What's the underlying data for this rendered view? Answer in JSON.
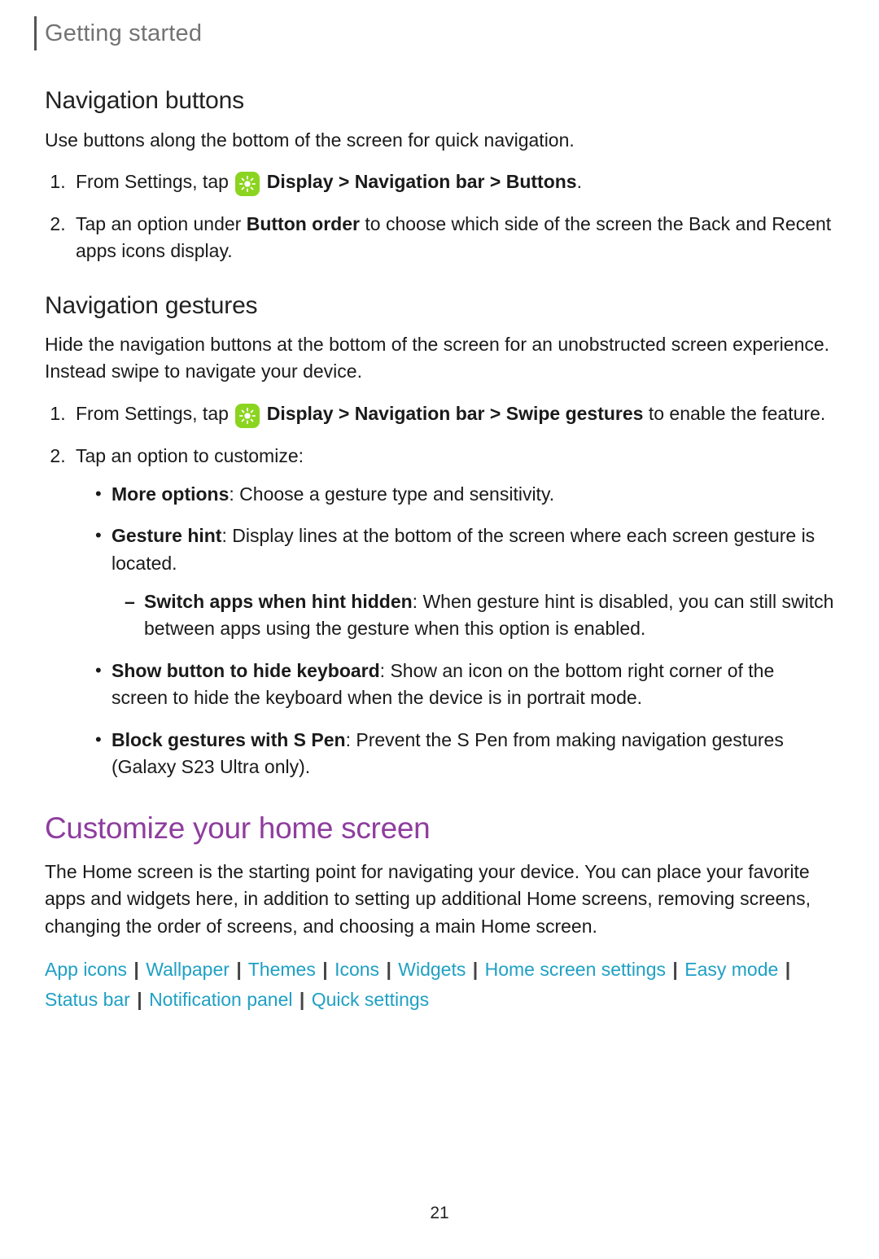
{
  "header": {
    "section": "Getting started"
  },
  "navButtons": {
    "title": "Navigation buttons",
    "intro": "Use buttons along the bottom of the screen for quick navigation.",
    "step1": {
      "lead": "From Settings, tap ",
      "pathA": "Display",
      "sepA": " > ",
      "pathB": "Navigation bar",
      "sepB": " > ",
      "pathC": "Buttons",
      "tail": "."
    },
    "step2": {
      "pre": "Tap an option under ",
      "bold": "Button order",
      "post": " to choose which side of the screen the Back and Recent apps icons display."
    }
  },
  "navGestures": {
    "title": "Navigation gestures",
    "intro": "Hide the navigation buttons at the bottom of the screen for an unobstructed screen experience. Instead swipe to navigate your device.",
    "step1": {
      "lead": "From Settings, tap ",
      "pathA": "Display",
      "sepA": " > ",
      "pathB": "Navigation bar",
      "sepB": " > ",
      "pathC": "Swipe gestures",
      "tail": " to enable the feature."
    },
    "step2": "Tap an option to customize:",
    "opt1": {
      "bold": "More options",
      "text": ": Choose a gesture type and sensitivity."
    },
    "opt2": {
      "bold": "Gesture hint",
      "text": ": Display lines at the bottom of the screen where each screen gesture is located."
    },
    "opt2sub": {
      "bold": "Switch apps when hint hidden",
      "text": ": When gesture hint is disabled, you can still switch between apps using the gesture when this option is enabled."
    },
    "opt3": {
      "bold": "Show button to hide keyboard",
      "text": ": Show an icon on the bottom right corner of the screen to hide the keyboard when the device is in portrait mode."
    },
    "opt4": {
      "bold": "Block gestures with S Pen",
      "text": ": Prevent the S Pen from making navigation gestures (Galaxy S23 Ultra only)."
    }
  },
  "customize": {
    "title": "Customize your home screen",
    "intro": "The Home screen is the starting point for navigating your device. You can place your favorite apps and widgets here, in addition to setting up additional Home screens, removing screens, changing the order of screens, and choosing a main Home screen."
  },
  "links": {
    "items": [
      "App icons",
      "Wallpaper",
      "Themes",
      "Icons",
      "Widgets",
      "Home screen settings",
      "Easy mode",
      "Status bar",
      "Notification panel",
      "Quick settings"
    ],
    "sep": "|"
  },
  "pageNumber": "21"
}
